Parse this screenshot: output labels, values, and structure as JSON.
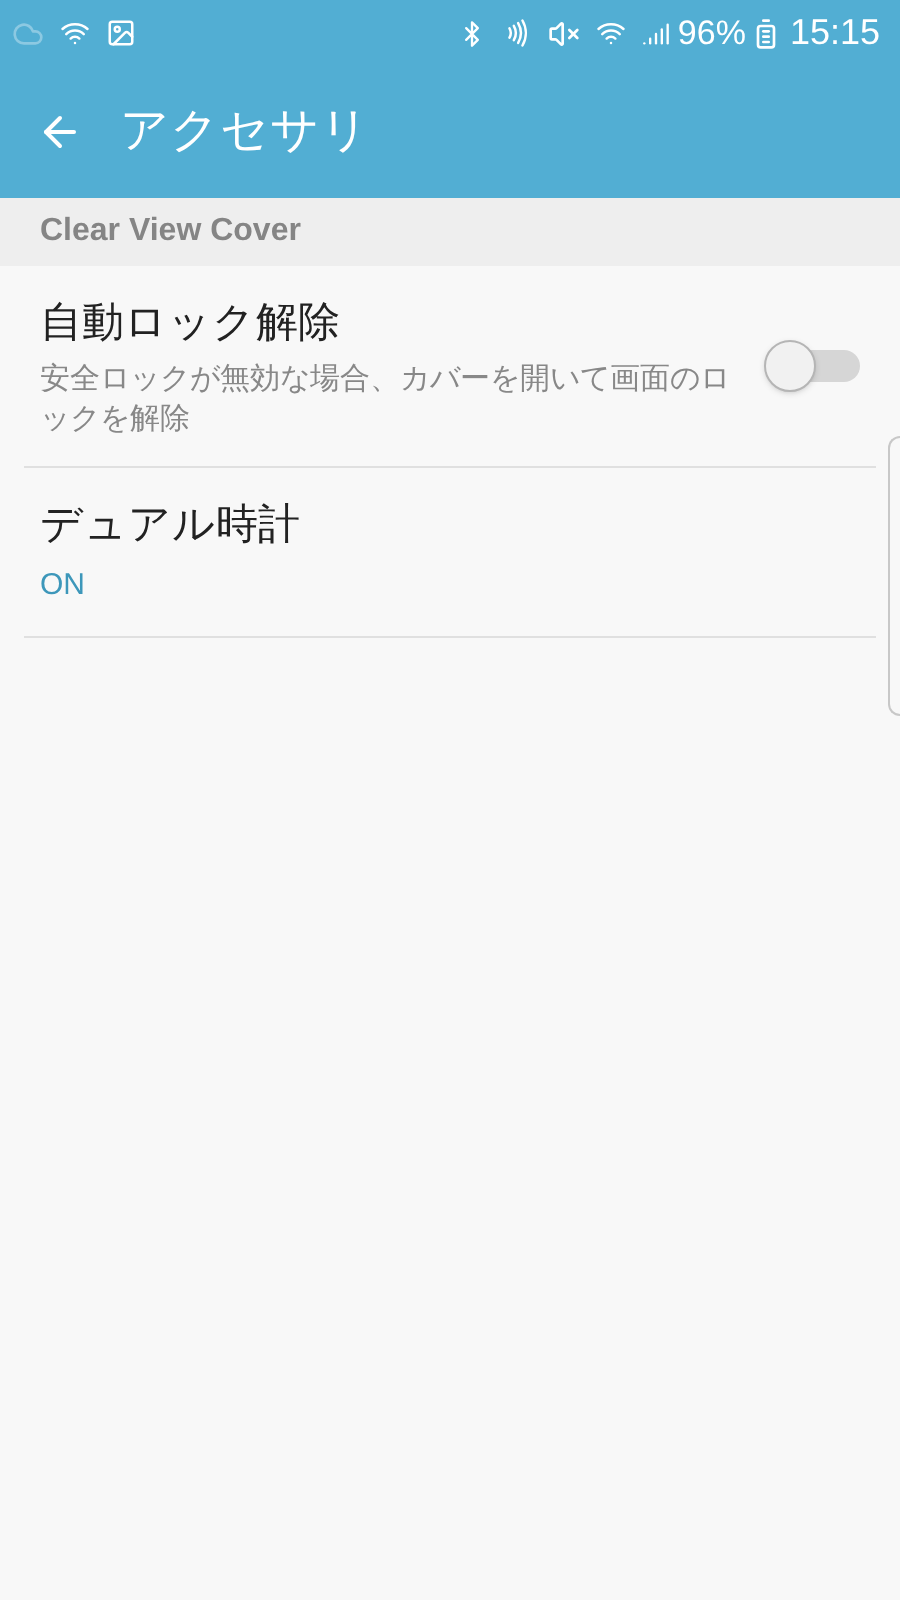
{
  "status_bar": {
    "battery_percent": "96%",
    "time": "15:15"
  },
  "app_bar": {
    "title": "アクセサリ"
  },
  "section": {
    "title": "Clear View Cover"
  },
  "items": [
    {
      "kind": "switch",
      "title": "自動ロック解除",
      "summary": "安全ロックが無効な場合、カバーを開いて画面のロックを解除",
      "on": false
    },
    {
      "kind": "value",
      "title": "デュアル時計",
      "value": "ON"
    }
  ]
}
